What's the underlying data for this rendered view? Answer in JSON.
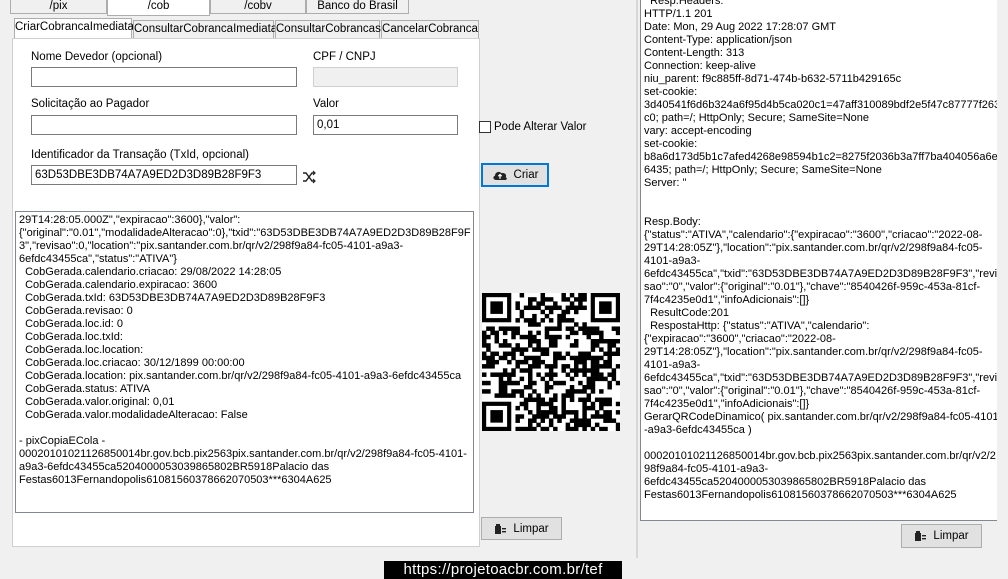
{
  "top_tabs": [
    "/pix",
    "/cob",
    "/cobv",
    "Banco do Brasil"
  ],
  "sub_tabs": [
    "CriarCobrancaImediata",
    "ConsultarCobrancaImediata",
    "ConsultarCobrancas",
    "CancelarCobranca"
  ],
  "form": {
    "nome_devedor_label": "Nome Devedor (opcional)",
    "nome_devedor_value": "",
    "cpf_label": "CPF / CNPJ",
    "cpf_value": "",
    "solicitacao_label": "Solicitação ao Pagador",
    "solicitacao_value": "",
    "valor_label": "Valor",
    "valor_value": "0,01",
    "pode_alterar_label": "Pode Alterar Valor",
    "txid_label": "Identificador da Transação (TxId, opcional)",
    "txid_value": "63D53DBE3DB74A7A9ED2D3D89B28F9F3",
    "criar_label": "Criar",
    "limpar_label": "Limpar"
  },
  "left_log": [
    "29T14:28:05.000Z\",\"expiracao\":3600},\"valor\":",
    "{\"original\":\"0.01\",\"modalidadeAlteracao\":0},\"txid\":\"63D53DBE3DB74A7A9ED2D3D89B28F9F",
    "3\",\"revisao\":0,\"location\":\"pix.santander.com.br/qr/v2/298f9a84-fc05-4101-a9a3-",
    "6efdc43455ca\",\"status\":\"ATIVA\"}",
    "  CobGerada.calendario.criacao: 29/08/2022 14:28:05",
    "  CobGerada.calendario.expiracao: 3600",
    "  CobGerada.txId: 63D53DBE3DB74A7A9ED2D3D89B28F9F3",
    "  CobGerada.revisao: 0",
    "  CobGerada.loc.id: 0",
    "  CobGerada.loc.txId:",
    "  CobGerada.loc.location:",
    "  CobGerada.loc.criacao: 30/12/1899 00:00:00",
    "  CobGerada.location: pix.santander.com.br/qr/v2/298f9a84-fc05-4101-a9a3-6efdc43455ca",
    "  CobGerada.status: ATIVA",
    "  CobGerada.valor.original: 0,01",
    "  CobGerada.valor.modalidadeAlteracao: False",
    "",
    "- pixCopiaECola -",
    "00020101021126850014br.gov.bcb.pix2563pix.santander.com.br/qr/v2/298f9a84-fc05-4101-",
    "a9a3-6efdc43455ca5204000053039865802BR5918Palacio das",
    "Festas6013Fernandopolis61081560378662070503***6304A625"
  ],
  "right_log": [
    "  Resp.Headers:",
    "HTTP/1.1 201",
    "Date: Mon, 29 Aug 2022 17:28:07 GMT",
    "Content-Type: application/json",
    "Content-Length: 313",
    "Connection: keep-alive",
    "niu_parent: f9c885ff-8d71-474b-b632-5711b429165c",
    "set-cookie:",
    "3d40541f6d6b324a6f95d4b5ca020c1=47aff310089bdf2e5f47c87777f263",
    "c0; path=/; HttpOnly; Secure; SameSite=None",
    "vary: accept-encoding",
    "set-cookie:",
    "b8a6d173d5b1c7afed4268e98594b1c2=8275f2036b3a7ff7ba404056a6e7",
    "6435; path=/; HttpOnly; Secure; SameSite=None",
    "Server: \"",
    "",
    "",
    "Resp.Body:",
    "{\"status\":\"ATIVA\",\"calendario\":{\"expiracao\":\"3600\",\"criacao\":\"2022-08-",
    "29T14:28:05Z\"},\"location\":\"pix.santander.com.br/qr/v2/298f9a84-fc05-",
    "4101-a9a3-",
    "6efdc43455ca\",\"txid\":\"63D53DBE3DB74A7A9ED2D3D89B28F9F3\",\"revi",
    "sao\":\"0\",\"valor\":{\"original\":\"0.01\"},\"chave\":\"8540426f-959c-453a-81cf-",
    "7f4c4235e0d1\",\"infoAdicionais\":[]}",
    "  ResultCode:201",
    "  RespostaHttp: {\"status\":\"ATIVA\",\"calendario\":",
    "{\"expiracao\":\"3600\",\"criacao\":\"2022-08-",
    "29T14:28:05Z\"},\"location\":\"pix.santander.com.br/qr/v2/298f9a84-fc05-",
    "4101-a9a3-",
    "6efdc43455ca\",\"txid\":\"63D53DBE3DB74A7A9ED2D3D89B28F9F3\",\"revi",
    "sao\":\"0\",\"valor\":{\"original\":\"0.01\"},\"chave\":\"8540426f-959c-453a-81cf-",
    "7f4c4235e0d1\",\"infoAdicionais\":[]}",
    "GerarQRCodeDinamico( pix.santander.com.br/qr/v2/298f9a84-fc05-4101",
    "-a9a3-6efdc43455ca )",
    "",
    "00020101021126850014br.gov.bcb.pix2563pix.santander.com.br/qr/v2/2",
    "98f9a84-fc05-4101-a9a3-",
    "6efdc43455ca5204000053039865802BR5918Palacio das",
    "Festas6013Fernandopolis61081560378662070503***6304A625"
  ],
  "right_limpar_label": "Limpar",
  "footer_url": "https://projetoacbr.com.br/tef",
  "icons": {
    "cloud": "cloud-upload-icon",
    "clear": "eraser-icon",
    "shuffle": "shuffle-icon"
  }
}
